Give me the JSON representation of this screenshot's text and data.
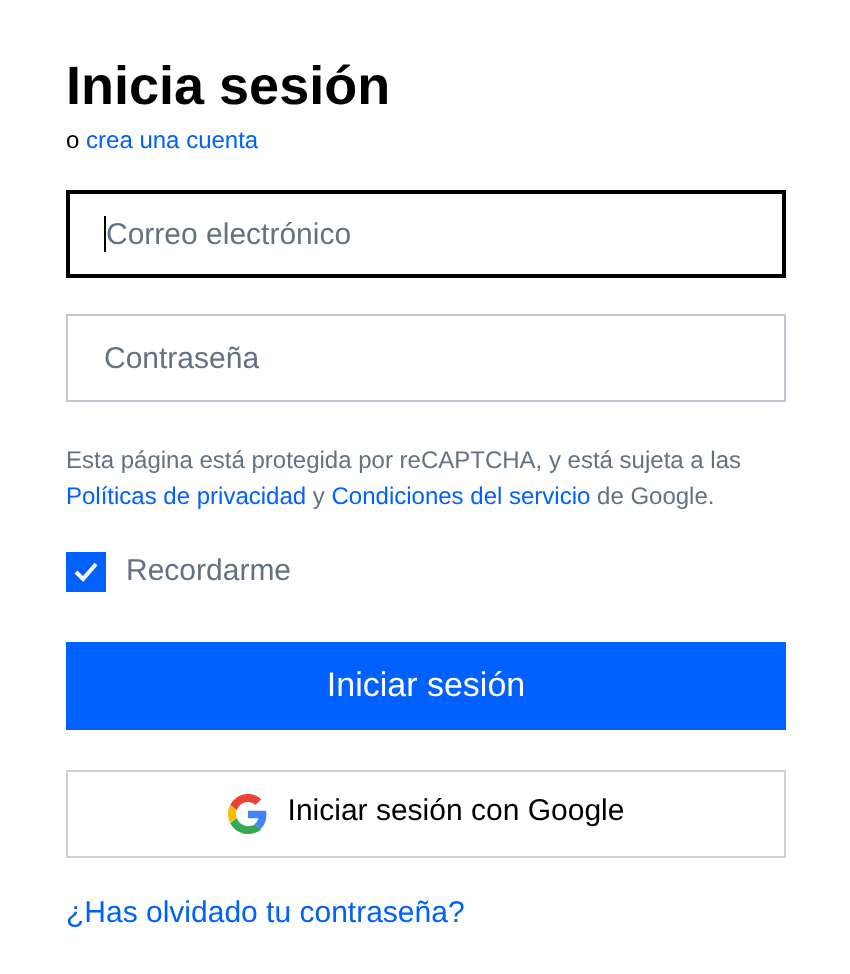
{
  "title": "Inicia sesión",
  "subtitle": [
    {
      "kind": "text",
      "text": "o"
    },
    {
      "kind": "link",
      "text": "crea una cuenta"
    }
  ],
  "fields": [
    {
      "placeholder": "Correo electrónico",
      "focused": true
    },
    {
      "placeholder": "Contraseña",
      "focused": false
    }
  ],
  "notice": [
    {
      "kind": "text",
      "text": "Esta página está protegida por reCAPTCHA, y está sujeta a las"
    },
    {
      "kind": "link",
      "text": "Políticas de privacidad"
    },
    {
      "kind": "text",
      "text": "y"
    },
    {
      "kind": "link",
      "text": "Condiciones del servicio"
    },
    {
      "kind": "text",
      "text": "de Google."
    }
  ],
  "remember": {
    "label": "Recordarme",
    "checked": true
  },
  "submit": "Iniciar sesión",
  "google_button": "Iniciar sesión con Google",
  "forgot_link": "¿Has olvidado tu contraseña?"
}
